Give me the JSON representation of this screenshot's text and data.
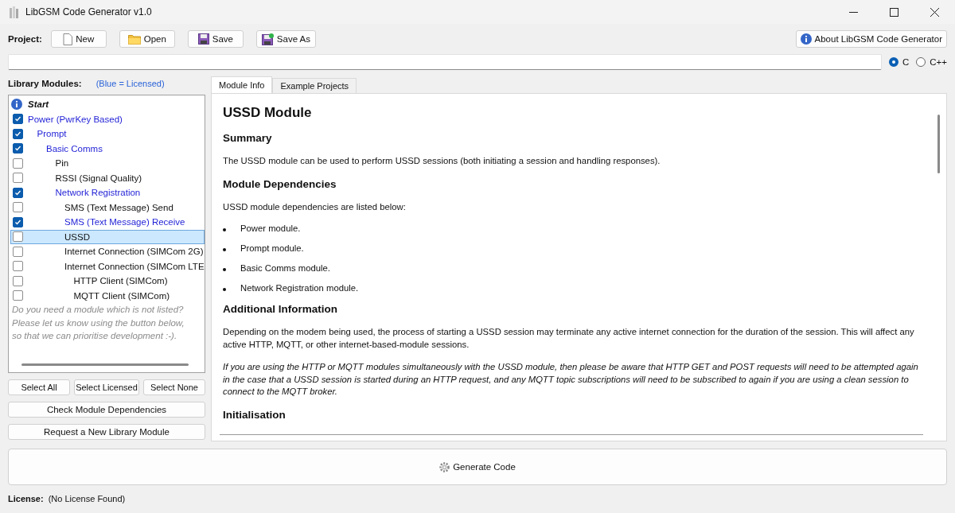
{
  "window": {
    "title": "LibGSM Code Generator v1.0"
  },
  "project": {
    "label": "Project:",
    "buttons": [
      {
        "label": "New",
        "kind": "new"
      },
      {
        "label": "Open",
        "kind": "open"
      },
      {
        "label": "Save",
        "kind": "save"
      },
      {
        "label": "Save As",
        "kind": "saveas"
      }
    ],
    "about_button": "About LibGSM Code Generator"
  },
  "language": [
    {
      "label": "C",
      "selected": true
    },
    {
      "label": "C++",
      "selected": false
    }
  ],
  "modules": {
    "label": "Library Modules:",
    "legend": "(Blue = Licensed)",
    "tree": [
      {
        "label": "Start",
        "kind": "info"
      },
      {
        "label": "Power (PwrKey Based)",
        "kind": "check",
        "checked": true,
        "licensed": true,
        "selected": false,
        "children": [
          {
            "label": "Prompt",
            "kind": "check",
            "checked": true,
            "licensed": true,
            "selected": false,
            "children": [
              {
                "label": "Basic Comms",
                "kind": "check",
                "checked": true,
                "licensed": true,
                "selected": false,
                "children": [
                  {
                    "label": "Pin",
                    "kind": "check",
                    "checked": false,
                    "licensed": false,
                    "selected": false
                  },
                  {
                    "label": "RSSI (Signal Quality)",
                    "kind": "check",
                    "checked": false,
                    "licensed": false,
                    "selected": false
                  },
                  {
                    "label": "Network Registration",
                    "kind": "check",
                    "checked": true,
                    "licensed": true,
                    "selected": false,
                    "children": [
                      {
                        "label": "SMS (Text Message) Send",
                        "kind": "check",
                        "checked": false,
                        "licensed": false,
                        "selected": false
                      },
                      {
                        "label": "SMS (Text Message) Receive",
                        "kind": "check",
                        "checked": true,
                        "licensed": true,
                        "selected": false
                      },
                      {
                        "label": "USSD",
                        "kind": "check",
                        "checked": false,
                        "licensed": false,
                        "selected": true
                      },
                      {
                        "label": "Internet Connection (SIMCom 2G)",
                        "kind": "check",
                        "checked": false,
                        "licensed": false,
                        "selected": false
                      },
                      {
                        "label": "Internet Connection (SIMCom LTE",
                        "kind": "check",
                        "checked": false,
                        "licensed": false,
                        "selected": false,
                        "children": [
                          {
                            "label": "HTTP Client (SIMCom)",
                            "kind": "check",
                            "checked": false,
                            "licensed": false,
                            "selected": false
                          },
                          {
                            "label": "MQTT Client (SIMCom)",
                            "kind": "check",
                            "checked": false,
                            "licensed": false,
                            "selected": false
                          }
                        ]
                      }
                    ]
                  }
                ]
              }
            ]
          }
        ]
      }
    ],
    "note": "Do you need a module which is not listed? Please let us know using the button below, so that we can prioritise development :-).",
    "select_buttons": [
      "Select All",
      "Select Licensed",
      "Select None"
    ],
    "wide_buttons": [
      "Check Module Dependencies",
      "Request a New Library Module"
    ]
  },
  "tabs": [
    {
      "label": "Module Info",
      "selected": true
    },
    {
      "label": "Example Projects",
      "selected": false
    }
  ],
  "document": [
    {
      "kind": "title",
      "text": "USSD Module"
    },
    {
      "kind": "heading",
      "text": "Summary"
    },
    {
      "kind": "para",
      "text": "The USSD module can be used to perform USSD sessions (both initiating a session and handling responses)."
    },
    {
      "kind": "heading",
      "text": "Module Dependencies"
    },
    {
      "kind": "para",
      "text": "USSD module dependencies are listed below:"
    },
    {
      "kind": "bullet",
      "text": "Power module."
    },
    {
      "kind": "bullet",
      "text": "Prompt module."
    },
    {
      "kind": "bullet",
      "text": "Basic Comms module."
    },
    {
      "kind": "bullet",
      "text": "Network Registration module."
    },
    {
      "kind": "heading",
      "text": "Additional Information"
    },
    {
      "kind": "para",
      "text": "Depending on the modem being used, the process of starting a USSD session may terminate any active internet connection for the duration of the session. This will affect any active HTTP, MQTT, or other internet-based-module sessions."
    },
    {
      "kind": "note",
      "text": "If you are using the HTTP or MQTT modules simultaneously with the USSD module, then please be aware that HTTP GET and POST requests will need to be attempted again in the case that a USSD session is started during an HTTP request, and any MQTT topic subscriptions will need to be subscribed to again if you are using a clean session to connect to the MQTT broker."
    },
    {
      "kind": "heading",
      "text": "Initialisation"
    }
  ],
  "generate_button": "Generate Code",
  "status": {
    "label": "License:",
    "value": "(No License Found)"
  }
}
